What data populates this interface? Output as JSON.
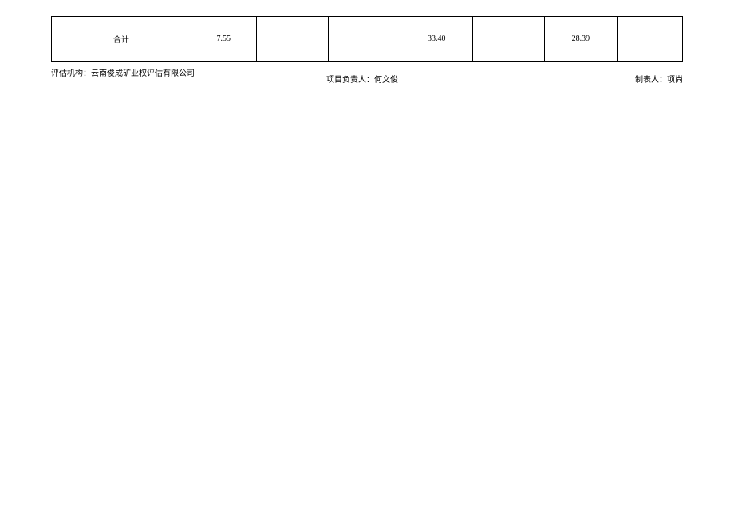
{
  "table": {
    "row": {
      "label": "合计",
      "col2": "7.55",
      "col3": "",
      "col4": "",
      "col5": "33.40",
      "col6": "",
      "col7": "28.39",
      "col8": ""
    }
  },
  "footer": {
    "left": "评估机构：云南俊成矿业权评估有限公司",
    "center": "项目负责人：何文俊",
    "right": "制表人：项尚"
  }
}
